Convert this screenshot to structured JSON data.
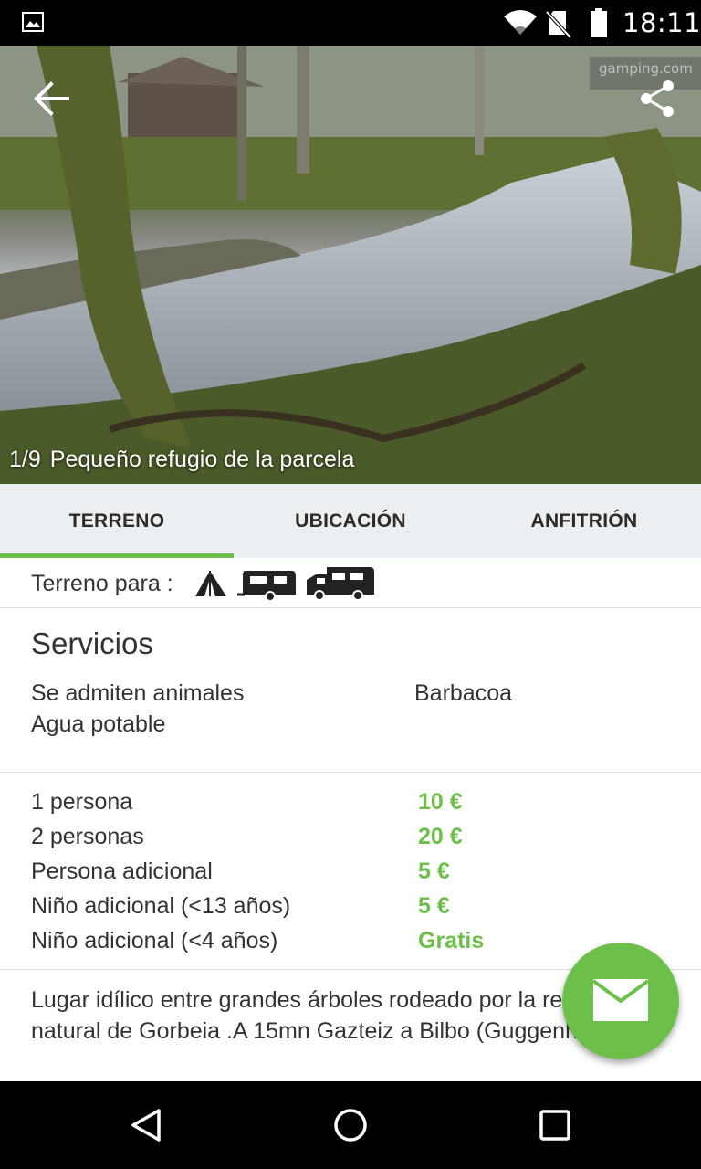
{
  "status_bar": {
    "time": "18:11"
  },
  "hero": {
    "watermark": "gamping.com",
    "photo_index": "1/9",
    "caption": "Pequeño refugio de la parcela"
  },
  "tabs": [
    {
      "label": "TERRENO",
      "active": true
    },
    {
      "label": "UBICACIÓN",
      "active": false
    },
    {
      "label": "ANFITRIÓN",
      "active": false
    }
  ],
  "terreno": {
    "label": "Terreno para :",
    "icons": [
      "tent-icon",
      "caravan-icon",
      "camper-van-icon"
    ]
  },
  "servicios": {
    "title": "Servicios",
    "left": [
      "Se admiten animales",
      "Agua potable"
    ],
    "right": [
      "Barbacoa"
    ]
  },
  "prices": [
    {
      "label": "1 persona",
      "value": "10 €"
    },
    {
      "label": "2 personas",
      "value": "20 €"
    },
    {
      "label": "Persona adicional",
      "value": "5 €"
    },
    {
      "label": "Niño adicional (<13 años)",
      "value": "5 €"
    },
    {
      "label": "Niño adicional (<4 años)",
      "value": "Gratis"
    }
  ],
  "description": "Lugar idílico entre grandes árboles rodeado por la reserva natural de Gorbeia .A  15mn Gazteiz a Bilbo (Guggenhein).",
  "colors": {
    "accent": "#6cc04a",
    "tab_bg": "#eceff1"
  },
  "fab": {
    "icon": "mail-icon"
  }
}
